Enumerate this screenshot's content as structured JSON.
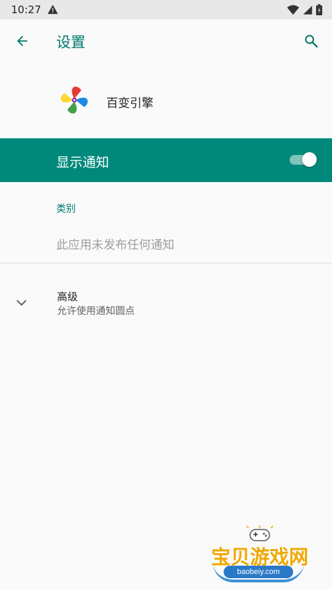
{
  "status_bar": {
    "time": "10:27",
    "icons": [
      "warning-icon",
      "wifi-icon",
      "signal-icon",
      "battery-icon"
    ]
  },
  "toolbar": {
    "title": "设置",
    "back_icon": "arrow-left-icon",
    "search_icon": "search-icon"
  },
  "app": {
    "name": "百变引擎"
  },
  "master_switch": {
    "label": "显示通知",
    "checked": true
  },
  "category": {
    "title": "类别",
    "empty_text": "此应用未发布任何通知"
  },
  "advanced": {
    "title": "高级",
    "summary": "允许使用通知圆点"
  },
  "watermark": {
    "text": "宝贝游戏网",
    "url": "baobeiy.com"
  },
  "colors": {
    "accent": "#00796b",
    "switch_bar": "#00897b",
    "status_bar": "#e8e8e8"
  }
}
